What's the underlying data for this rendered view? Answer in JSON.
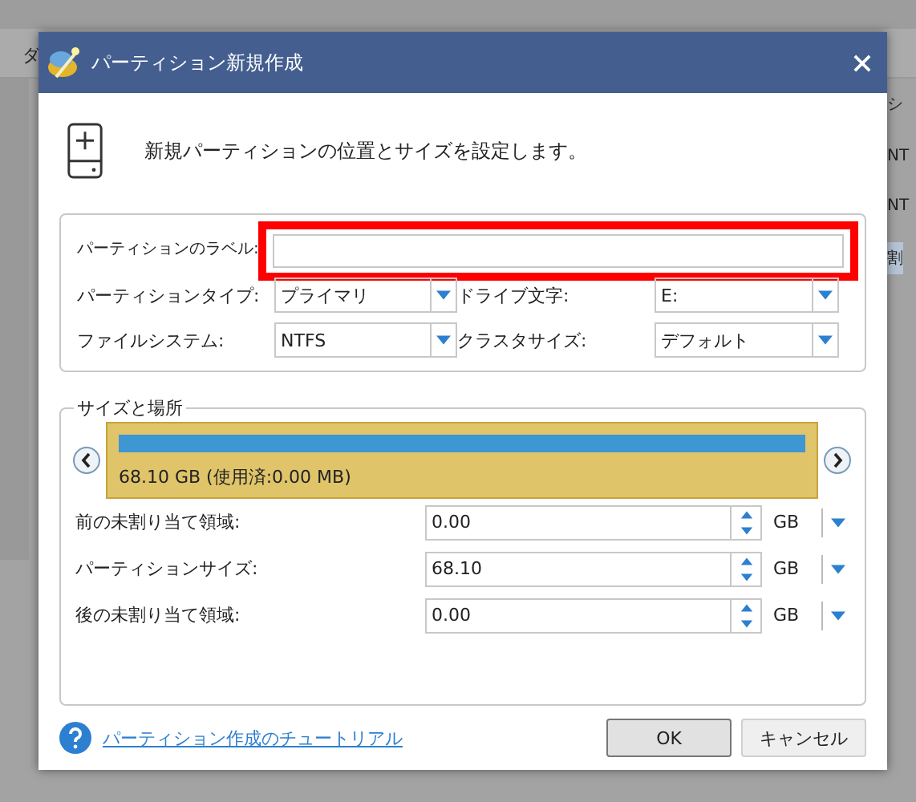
{
  "background_app": {
    "left_texts": [
      "ダ"
    ],
    "right_texts": [
      {
        "text": "シ",
        "selected": false
      },
      {
        "text": "NT",
        "selected": false
      },
      {
        "text": "NT",
        "selected": false
      },
      {
        "text": "割",
        "selected": true
      }
    ]
  },
  "dialog": {
    "title": "パーティション新規作成",
    "instruction": "新規パーティションの位置とサイズを設定します。",
    "label_field": {
      "label": "パーティションのラベル:",
      "highlighted": true
    },
    "dropdowns": [
      {
        "label": "パーティションタイプ:",
        "value": "プライマリ"
      },
      {
        "label": "ドライブ文字:",
        "value": "E:"
      },
      {
        "label": "ファイルシステム:",
        "value": "NTFS"
      },
      {
        "label": "クラスタサイズ:",
        "value": "デフォルト"
      }
    ],
    "size_location": {
      "title": "サイズと場所",
      "disk": {
        "caption": "68.10 GB (使用済:0.00 MB)"
      },
      "rows": [
        {
          "label": "前の未割り当て領域:",
          "value": "0.00",
          "unit": "GB"
        },
        {
          "label": "パーティションサイズ:",
          "value": "68.10",
          "unit": "GB"
        },
        {
          "label": "後の未割り当て領域:",
          "value": "0.00",
          "unit": "GB"
        }
      ]
    },
    "help_link": "パーティション作成のチュートリアル",
    "buttons": [
      {
        "label": "OK",
        "default": true
      },
      {
        "label": "キャンセル",
        "default": false
      }
    ]
  }
}
